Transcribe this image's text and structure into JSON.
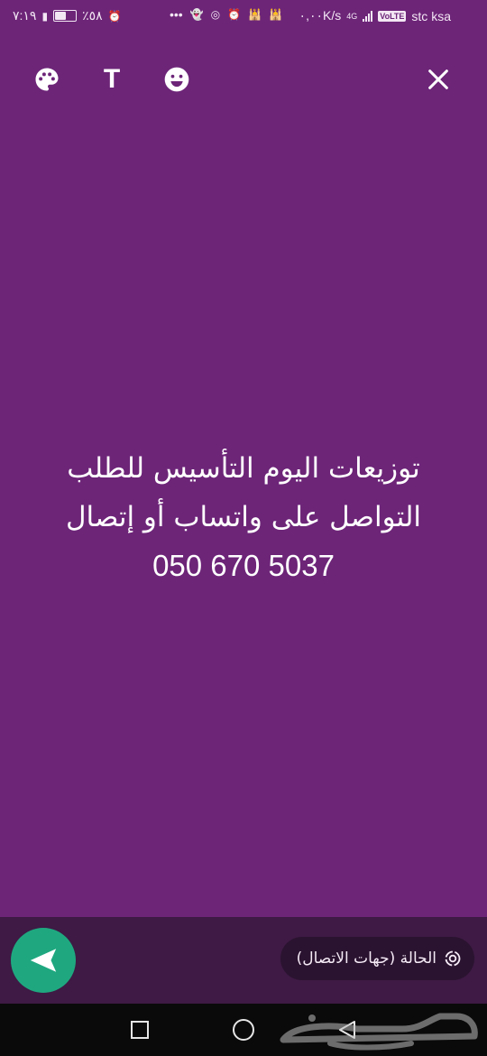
{
  "status_bar": {
    "time": "٧:١٩",
    "battery_percent": "٪٥٨",
    "battery_level": 0.58,
    "network_speed": "٠,٠٠K/s",
    "network_type": "4G",
    "volte": "VoLTE",
    "carrier": "stc ksa",
    "overflow": "•••"
  },
  "toolbar": {
    "text_tool_label": "T"
  },
  "status": {
    "line1": "توزيعات اليوم التأسيس للطلب",
    "line2": "التواصل على واتساب أو إتصال",
    "phone": "050 670 5037"
  },
  "bottom": {
    "audience_label": "الحالة (جهات الاتصال)"
  },
  "colors": {
    "background": "#6d2578",
    "send_button": "#1fa880",
    "bottom_panel": "#3e1a44",
    "chip": "#2a1330"
  }
}
